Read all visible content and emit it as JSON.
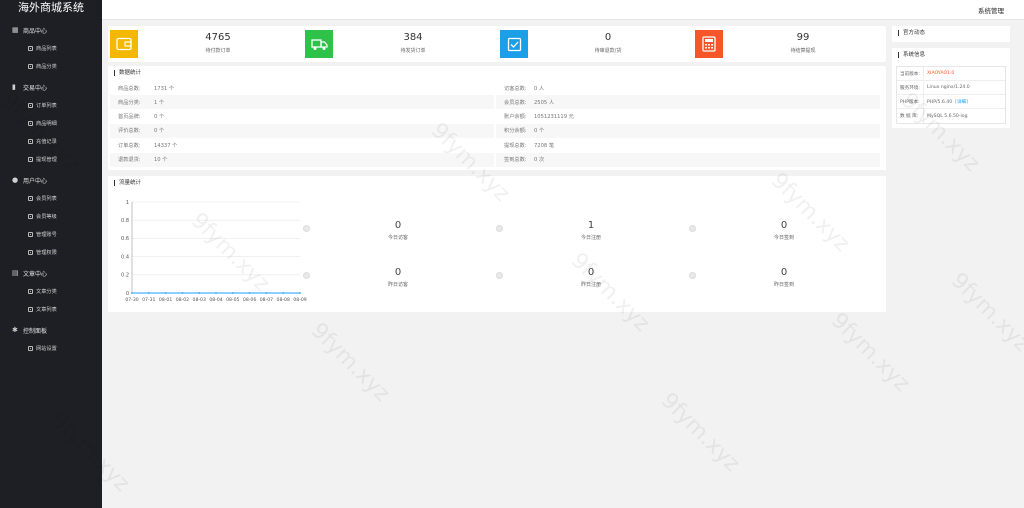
{
  "app": {
    "title": "海外商城系统",
    "header_right": "系统管理"
  },
  "sidebar": {
    "groups": [
      {
        "label": "商品中心",
        "icon": "grid-icon",
        "children": [
          "商品列表",
          "商品分类"
        ]
      },
      {
        "label": "交易中心",
        "icon": "bar-chart-icon",
        "children": [
          "订单列表",
          "商品明细",
          "充值记录",
          "提现管理"
        ]
      },
      {
        "label": "用户中心",
        "icon": "user-icon",
        "children": [
          "会员列表",
          "会员等级",
          "管理账号",
          "管理权限"
        ]
      },
      {
        "label": "文章中心",
        "icon": "document-icon",
        "children": [
          "文章分类",
          "文章列表"
        ]
      },
      {
        "label": "控制面板",
        "icon": "gear-icon",
        "children": [
          "网站设置"
        ]
      }
    ]
  },
  "stats": [
    {
      "value": "4765",
      "label": "待付款订单",
      "color": "#f5b800",
      "icon": "wallet-icon"
    },
    {
      "value": "384",
      "label": "待发货订单",
      "color": "#2fc24a",
      "icon": "truck-icon"
    },
    {
      "value": "0",
      "label": "待审退款/货",
      "color": "#1ba0e8",
      "icon": "checkbox-icon"
    },
    {
      "value": "99",
      "label": "待结算提现",
      "color": "#f7562a",
      "icon": "calculator-icon"
    }
  ],
  "data_stats": {
    "title": "数据统计",
    "left": [
      {
        "key": "商品总数:",
        "value": "1731 个"
      },
      {
        "key": "商品分类:",
        "value": "1 个"
      },
      {
        "key": "首页品牌:",
        "value": "0 个"
      },
      {
        "key": "评价总数:",
        "value": "0 个"
      },
      {
        "key": "订单总数:",
        "value": "14337 个"
      },
      {
        "key": "退款退货:",
        "value": "10 个"
      }
    ],
    "right": [
      {
        "key": "访客总数:",
        "value": "0 人"
      },
      {
        "key": "会员总数:",
        "value": "2505 人"
      },
      {
        "key": "账户余额:",
        "value": "1051231119 元"
      },
      {
        "key": "积分余额:",
        "value": "0 个"
      },
      {
        "key": "提现总数:",
        "value": "7208 笔"
      },
      {
        "key": "签到总数:",
        "value": "0 次"
      }
    ]
  },
  "flow": {
    "title": "流量统计",
    "metrics": [
      {
        "value": "0",
        "label": "今日访客"
      },
      {
        "value": "1",
        "label": "今日注册"
      },
      {
        "value": "0",
        "label": "今日签到"
      },
      {
        "value": "0",
        "label": "昨日访客"
      },
      {
        "value": "0",
        "label": "昨日注册"
      },
      {
        "value": "0",
        "label": "昨日签到"
      }
    ]
  },
  "chart_data": {
    "type": "line",
    "categories": [
      "07-30",
      "07-31",
      "08-01",
      "08-02",
      "08-03",
      "08-04",
      "08-05",
      "08-06",
      "08-07",
      "08-08",
      "08-09"
    ],
    "series": [
      {
        "values": [
          0,
          0,
          0,
          0,
          0,
          0,
          0,
          0,
          0,
          0,
          0
        ]
      }
    ],
    "y_ticks": [
      "0",
      "0.2",
      "0.4",
      "0.6",
      "0.8",
      "1"
    ],
    "ylim": [
      0,
      1
    ],
    "grid": true,
    "line_color": "#1e9fff"
  },
  "news": {
    "title": "官方动态"
  },
  "sysinfo": {
    "title": "系统信息",
    "rows": [
      {
        "key": "当前版本:",
        "value": "XIAOYAO1.0",
        "link": ""
      },
      {
        "key": "服务环境:",
        "value": "Linux nginx/1.24.0",
        "link": ""
      },
      {
        "key": "PHP版本:",
        "value": "PHP/5.6.40",
        "link": "[详细]"
      },
      {
        "key": "数 据 库:",
        "value": "MySQL 5.6.50-log",
        "link": ""
      }
    ]
  },
  "watermark_text": "9fym.xyz"
}
